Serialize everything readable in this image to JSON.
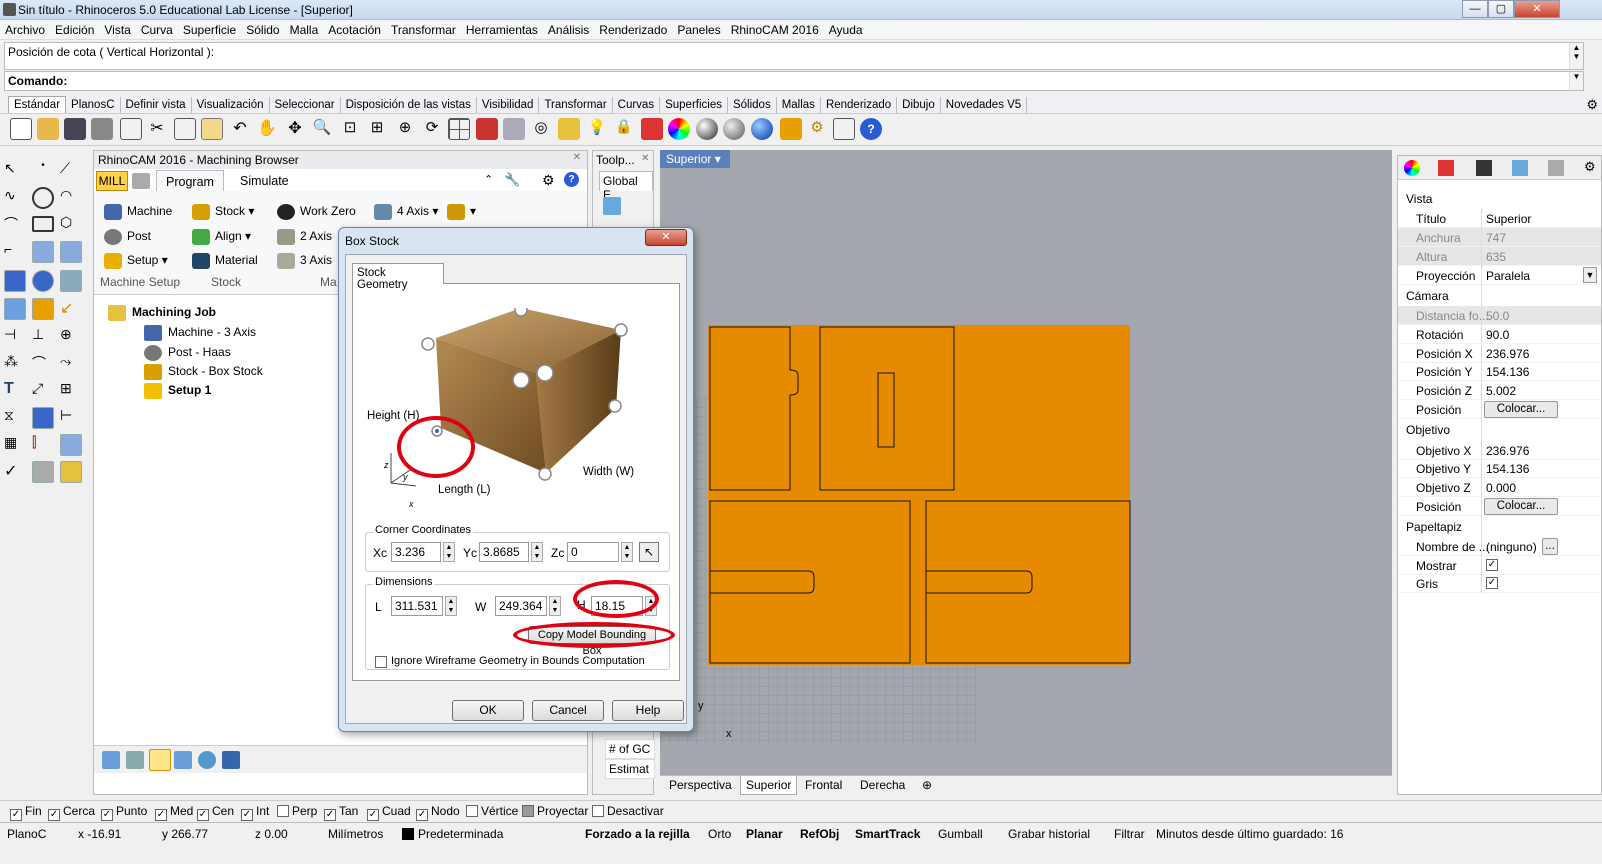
{
  "window": {
    "title": "Sin título - Rhinoceros 5.0 Educational Lab License - [Superior]"
  },
  "menu": [
    "Archivo",
    "Edición",
    "Vista",
    "Curva",
    "Superficie",
    "Sólido",
    "Malla",
    "Acotación",
    "Transformar",
    "Herramientas",
    "Análisis",
    "Renderizado",
    "Paneles",
    "RhinoCAM 2016",
    "Ayuda"
  ],
  "command": {
    "history": "Posición de cota ( Vertical  Horizontal ):",
    "prompt": "Comando:"
  },
  "tabs": [
    "Estándar",
    "PlanosC",
    "Definir vista",
    "Visualización",
    "Seleccionar",
    "Disposición de las vistas",
    "Visibilidad",
    "Transformar",
    "Curvas",
    "Superficies",
    "Sólidos",
    "Mallas",
    "Renderizado",
    "Dibujo",
    "Novedades V5"
  ],
  "browser": {
    "title": "RhinoCAM 2016 - Machining Browser",
    "mode": "MILL",
    "tab_program": "Program",
    "tab_simulate": "Simulate",
    "machine_setup": {
      "machine": "Machine",
      "post": "Post",
      "setup": "Setup",
      "group": "Machine Setup"
    },
    "stock": {
      "stock": "Stock",
      "align": "Align",
      "material": "Material",
      "group": "Stock"
    },
    "ops": {
      "work_zero": "Work Zero",
      "axis4": "4 Axis",
      "axis2": "2 Axis",
      "axis3": "3 Axis",
      "group": "Ma"
    },
    "tree": {
      "job": "Machining Job",
      "machine": "Machine - 3 Axis",
      "post": "Post - Haas",
      "stock": "Stock - Box Stock",
      "setup": "Setup 1"
    }
  },
  "toolpath": {
    "title": "Toolp...",
    "tab": "Global E",
    "row1": "# of GC",
    "row2": "Estimat"
  },
  "viewport": {
    "label": "Superior",
    "axis_y": "y",
    "axis_x": "x",
    "tabs": [
      "Perspectiva",
      "Superior",
      "Frontal",
      "Derecha"
    ]
  },
  "dialog": {
    "title": "Box Stock",
    "tab": "Stock Geometry",
    "height_label": "Height (H)",
    "length_label": "Length (L)",
    "width_label": "Width (W)",
    "axis_x": "x",
    "axis_y": "y",
    "axis_z": "z",
    "corner": {
      "label": "Corner Coordinates",
      "xc_label": "Xc",
      "xc": "3.236",
      "yc_label": "Yc",
      "yc": "3.8685",
      "zc_label": "Zc",
      "zc": "0"
    },
    "dims": {
      "label": "Dimensions",
      "l_label": "L",
      "l": "311.531",
      "w_label": "W",
      "w": "249.364",
      "h_label": "H",
      "h": "18.15"
    },
    "copy_btn": "Copy Model Bounding Box",
    "ignore_label": "Ignore Wireframe Geometry in Bounds Computation",
    "ok": "OK",
    "cancel": "Cancel",
    "help": "Help"
  },
  "props": {
    "vista": "Vista",
    "titulo_k": "Título",
    "titulo_v": "Superior",
    "anchura_k": "Anchura",
    "anchura_v": "747",
    "altura_k": "Altura",
    "altura_v": "635",
    "proy_k": "Proyección",
    "proy_v": "Paralela",
    "camara": "Cámara",
    "dist_k": "Distancia fo...",
    "dist_v": "50.0",
    "rot_k": "Rotación",
    "rot_v": "90.0",
    "px_k": "Posición X",
    "px_v": "236.976",
    "py_k": "Posición Y",
    "py_v": "154.136",
    "pz_k": "Posición Z",
    "pz_v": "5.002",
    "pos_k": "Posición",
    "colocar": "Colocar...",
    "objetivo": "Objetivo",
    "ox_k": "Objetivo X",
    "ox_v": "236.976",
    "oy_k": "Objetivo Y",
    "oy_v": "154.136",
    "oz_k": "Objetivo Z",
    "oz_v": "0.000",
    "opos_k": "Posición",
    "papel": "Papeltapiz",
    "nombre_k": "Nombre de ...",
    "nombre_v": "(ninguno)",
    "mostrar_k": "Mostrar",
    "gris_k": "Gris"
  },
  "osnaps": [
    {
      "label": "Fin",
      "checked": true
    },
    {
      "label": "Cerca",
      "checked": true
    },
    {
      "label": "Punto",
      "checked": true
    },
    {
      "label": "Med",
      "checked": true
    },
    {
      "label": "Cen",
      "checked": true
    },
    {
      "label": "Int",
      "checked": true
    },
    {
      "label": "Perp",
      "checked": false
    },
    {
      "label": "Tan",
      "checked": true
    },
    {
      "label": "Cuad",
      "checked": true
    },
    {
      "label": "Nodo",
      "checked": true
    },
    {
      "label": "Vértice",
      "checked": false
    },
    {
      "label": "Proyectar",
      "checked": false
    },
    {
      "label": "Desactivar",
      "checked": false
    }
  ],
  "status": {
    "plane": "PlanoC",
    "x": "x -16.91",
    "y": "y 266.77",
    "z": "z 0.00",
    "units": "Milímetros",
    "layer": "Predeterminada",
    "grid": "Forzado a la rejilla",
    "orto": "Orto",
    "planar": "Planar",
    "refobj": "RefObj",
    "smarttrack": "SmartTrack",
    "gumball": "Gumball",
    "history": "Grabar historial",
    "filtrar": "Filtrar",
    "saved": "Minutos desde último guardado: 16"
  },
  "colors": {
    "part": "#e68a00",
    "annotation": "#e00012"
  }
}
